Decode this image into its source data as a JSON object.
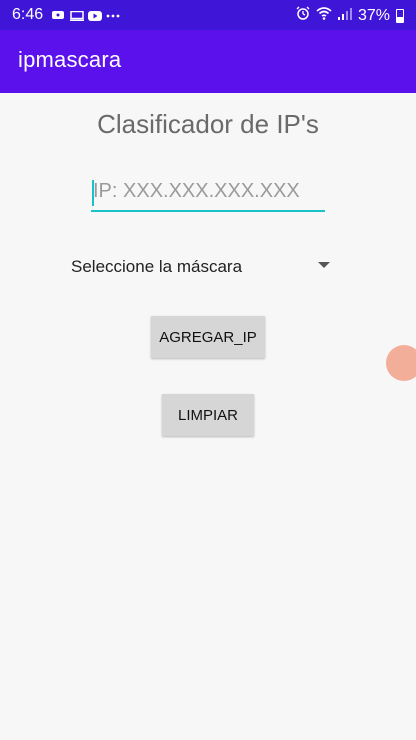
{
  "status_bar": {
    "time": "6:46",
    "left_icons": [
      "message-icon",
      "monitor-icon",
      "youtube-icon",
      "more-dots-icon"
    ],
    "right_icons": [
      "alarm-icon",
      "wifi-icon",
      "signal-icon"
    ],
    "battery": "37%"
  },
  "app_bar": {
    "title": "ipmascara"
  },
  "main": {
    "heading": "Clasificador de  IP's",
    "ip_input": {
      "value": "",
      "placeholder": "IP: XXX.XXX.XXX.XXX"
    },
    "mask_spinner": {
      "selected": "Seleccione la máscara"
    },
    "buttons": {
      "add_ip": "AGREGAR_IP",
      "clear": "LIMPIAR"
    }
  },
  "colors": {
    "status_bar": "#3f16d8",
    "app_bar": "#5b11ec",
    "accent": "#18c2c8",
    "button_bg": "#d6d6d6",
    "touch_indicator": "#f2a58e"
  }
}
